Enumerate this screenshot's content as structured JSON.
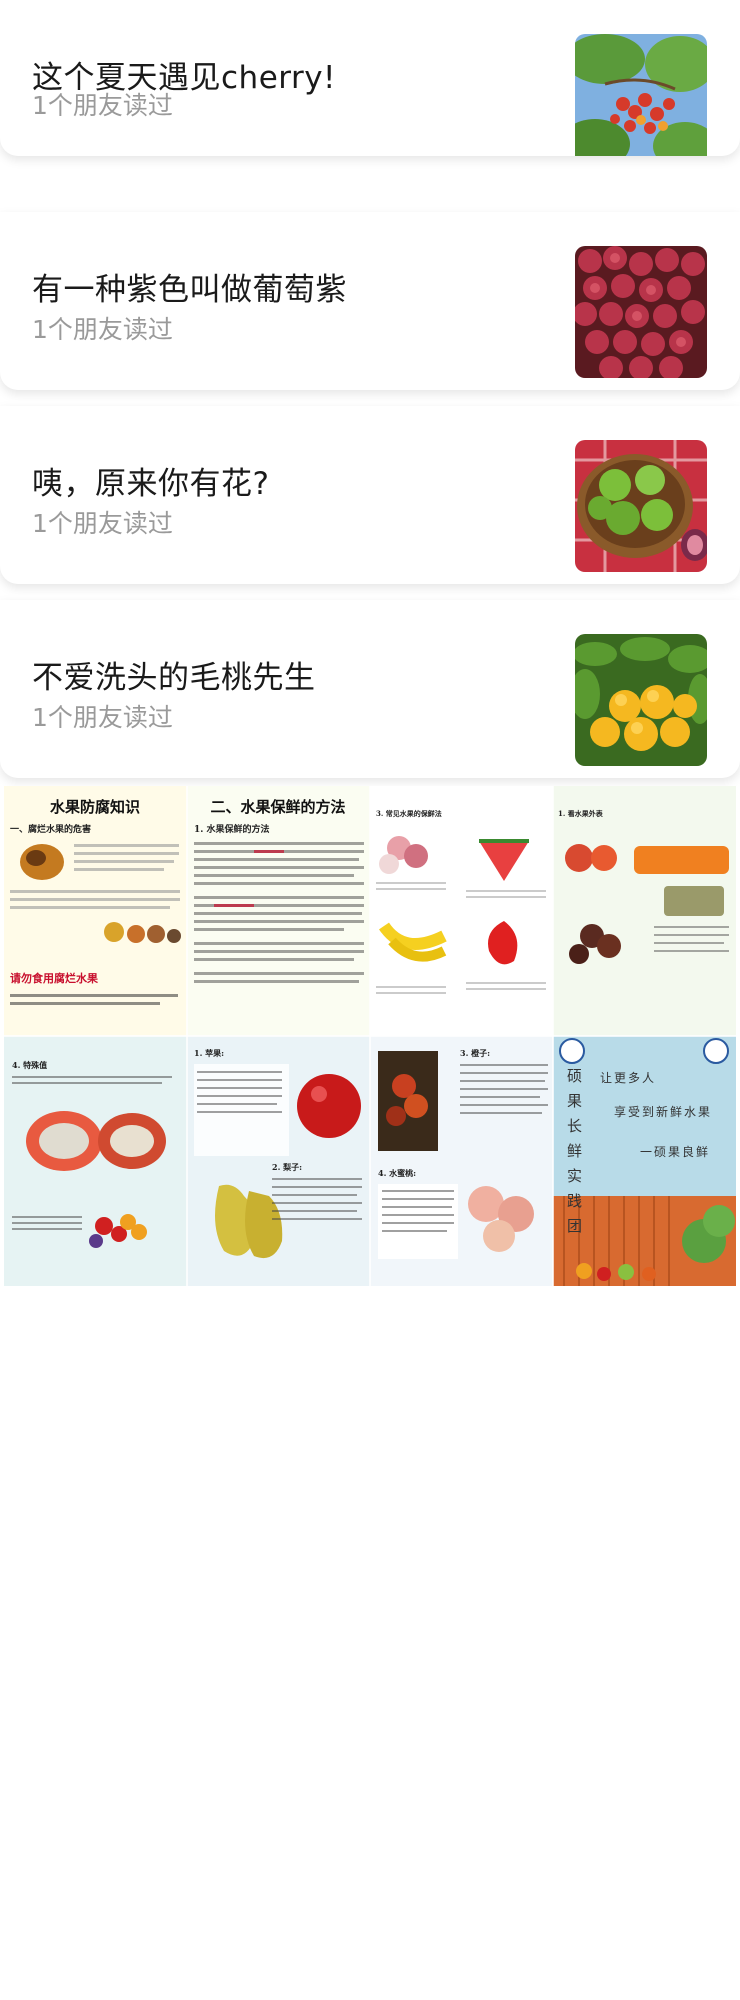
{
  "articles": [
    {
      "title": "这个夏天遇见cherry!",
      "readers": "1个朋友读过",
      "thumb_icon": "cherry-photo"
    },
    {
      "title": "有一种紫色叫做葡萄紫",
      "readers": "1个朋友读过",
      "thumb_icon": "grape-photo"
    },
    {
      "title": "咦，原来你有花?",
      "readers": "1个朋友读过",
      "thumb_icon": "fig-photo"
    },
    {
      "title": "不爱洗头的毛桃先生",
      "readers": "1个朋友读过",
      "thumb_icon": "peach-photo"
    }
  ],
  "poster": {
    "panel1": {
      "title": "水果防腐知识",
      "heading": "一、腐烂水果的危害",
      "foot": "请勿食用腐烂水果"
    },
    "panel2": {
      "title": "二、水果保鲜的方法",
      "heading": "1. 水果保鲜的方法"
    },
    "panel3": {
      "heading": "3. 常见水果的保鲜法"
    },
    "panel4": {
      "heading": "1. 看水果外表"
    },
    "panel5": {
      "heading": "4. 特殊值"
    },
    "panel6": {
      "heading1": "1. 苹果:",
      "heading2": "2. 梨子:"
    },
    "panel7": {
      "heading1": "3. 橙子:",
      "heading2": "4. 水蜜桃:"
    },
    "panel8": {
      "vertical_chars": [
        "硕",
        "果",
        "长",
        "鲜",
        "实",
        "践",
        "团"
      ],
      "line1": "让更多人",
      "line2": "享受到新鲜水果",
      "line3": "一硕果良鲜"
    }
  },
  "colors": {
    "title": "#1a1a1a",
    "sub": "#9a9a9a",
    "accent": "#c8102e"
  }
}
